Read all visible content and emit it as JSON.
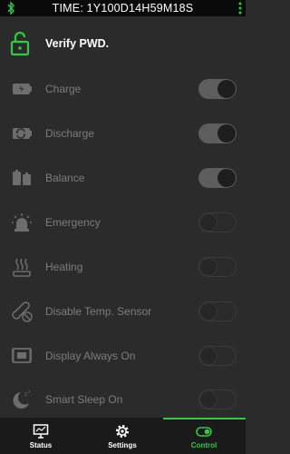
{
  "header": {
    "title": "TIME: 1Y100D14H59M18S"
  },
  "verify": {
    "label": "Verify PWD."
  },
  "settings": [
    {
      "label": "Charge",
      "on": true
    },
    {
      "label": "Discharge",
      "on": true
    },
    {
      "label": "Balance",
      "on": true
    },
    {
      "label": "Emergency",
      "on": false
    },
    {
      "label": "Heating",
      "on": false
    },
    {
      "label": "Disable Temp. Sensor",
      "on": false
    },
    {
      "label": "Display Always On",
      "on": false
    },
    {
      "label": "Smart Sleep On",
      "on": false
    }
  ],
  "tabs": [
    {
      "label": "Status",
      "icon": "monitor-icon",
      "active": false
    },
    {
      "label": "Settings",
      "icon": "gear-icon",
      "active": false
    },
    {
      "label": "Control",
      "icon": "toggle-icon",
      "active": true
    }
  ],
  "colors": {
    "accent": "#2ecc40",
    "background": "#2b2b2b",
    "bar": "#0a0a0a"
  }
}
